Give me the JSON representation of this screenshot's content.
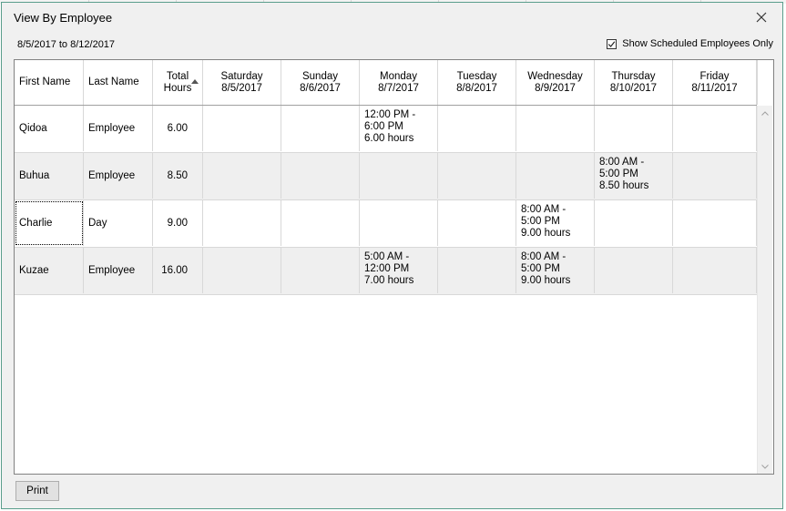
{
  "window": {
    "title": "View By Employee",
    "date_range": "8/5/2017 to 8/12/2017"
  },
  "options": {
    "show_scheduled_label": "Show Scheduled Employees Only",
    "show_scheduled_checked": true
  },
  "columns": [
    {
      "line1": "First Name",
      "line2": ""
    },
    {
      "line1": "Last Name",
      "line2": ""
    },
    {
      "line1": "Total",
      "line2": "Hours"
    },
    {
      "line1": "Saturday",
      "line2": "8/5/2017"
    },
    {
      "line1": "Sunday",
      "line2": "8/6/2017"
    },
    {
      "line1": "Monday",
      "line2": "8/7/2017"
    },
    {
      "line1": "Tuesday",
      "line2": "8/8/2017"
    },
    {
      "line1": "Wednesday",
      "line2": "8/9/2017"
    },
    {
      "line1": "Thursday",
      "line2": "8/10/2017"
    },
    {
      "line1": "Friday",
      "line2": "8/11/2017"
    }
  ],
  "rows": [
    {
      "first": "Qidoa",
      "last": "Employee",
      "total": "6.00",
      "days": [
        "",
        "",
        "12:00 PM -\n6:00 PM\n6.00 hours",
        "",
        "",
        "",
        ""
      ]
    },
    {
      "first": "Buhua",
      "last": "Employee",
      "total": "8.50",
      "days": [
        "",
        "",
        "",
        "",
        "",
        "8:00 AM -\n5:00 PM\n8.50 hours",
        ""
      ]
    },
    {
      "first": "Charlie",
      "last": "Day",
      "total": "9.00",
      "days": [
        "",
        "",
        "",
        "",
        "8:00 AM -\n5:00 PM\n9.00 hours",
        "",
        ""
      ]
    },
    {
      "first": "Kuzae",
      "last": "Employee",
      "total": "16.00",
      "days": [
        "",
        "",
        "5:00 AM -\n12:00 PM\n7.00 hours",
        "",
        "8:00 AM -\n5:00 PM\n9.00 hours",
        "",
        ""
      ]
    }
  ],
  "footer": {
    "print_label": "Print"
  }
}
